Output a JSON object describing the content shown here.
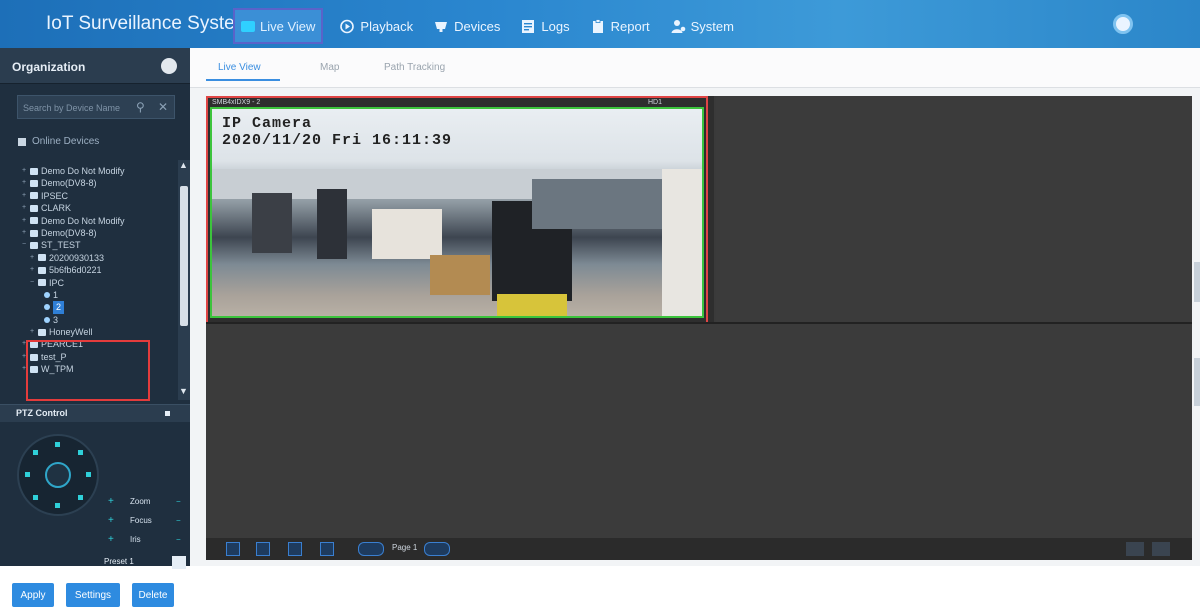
{
  "header": {
    "app_title": "IoT Surveillance System",
    "nav": [
      {
        "label": "Live View",
        "icon": "live-view-icon",
        "active": true
      },
      {
        "label": "Playback",
        "icon": "playback-icon"
      },
      {
        "label": "Devices",
        "icon": "devices-icon"
      },
      {
        "label": "Logs",
        "icon": "logs-icon"
      },
      {
        "label": "Report",
        "icon": "report-icon"
      },
      {
        "label": "System",
        "icon": "system-icon"
      }
    ]
  },
  "sidebar": {
    "title": "Organization",
    "search_placeholder": "Search by Device Name",
    "online_label": "Online Devices",
    "tree": [
      {
        "label": "Demo Do Not Modify",
        "type": "device"
      },
      {
        "label": "Demo(DV8-8)",
        "type": "device"
      },
      {
        "label": "IPSEC",
        "type": "device"
      },
      {
        "label": "CLARK",
        "type": "device"
      },
      {
        "label": "Demo Do Not Modify",
        "type": "device"
      },
      {
        "label": "Demo(DV8-8)",
        "type": "device"
      },
      {
        "label": "ST_TEST",
        "type": "device"
      },
      {
        "label": "20200930133",
        "type": "device"
      },
      {
        "label": "5b6fb6d0221",
        "type": "device"
      },
      {
        "label": "IPC",
        "type": "device"
      },
      {
        "label": "1",
        "type": "camera"
      },
      {
        "label": "2",
        "type": "camera",
        "selected": true
      },
      {
        "label": "3",
        "type": "camera"
      },
      {
        "label": "HoneyWell",
        "type": "device"
      },
      {
        "label": "PEARCE1",
        "type": "device"
      },
      {
        "label": "test_P",
        "type": "device"
      },
      {
        "label": "W_TPM",
        "type": "device"
      }
    ],
    "ptz": {
      "title": "PTZ Control",
      "rows": [
        "Zoom",
        "Focus",
        "Iris"
      ],
      "preset_label": "Preset 1"
    },
    "buttons": {
      "apply": "Apply",
      "settings": "Settings",
      "delete": "Delete"
    }
  },
  "main": {
    "tabs": [
      "Live View",
      "Map",
      "Path Tracking"
    ],
    "camera_label": "SMB4xIDX9 - 2",
    "camera_status": "HD1",
    "osd_line1": "IP Camera",
    "osd_line2": "2020/11/20 Fri 16:11:39",
    "page_label": "Page 1"
  },
  "colors": {
    "accent": "#2e8be0",
    "topbar": "#2a86cf",
    "highlight": "#e43c3c",
    "video_frame": "#3cc43c"
  }
}
